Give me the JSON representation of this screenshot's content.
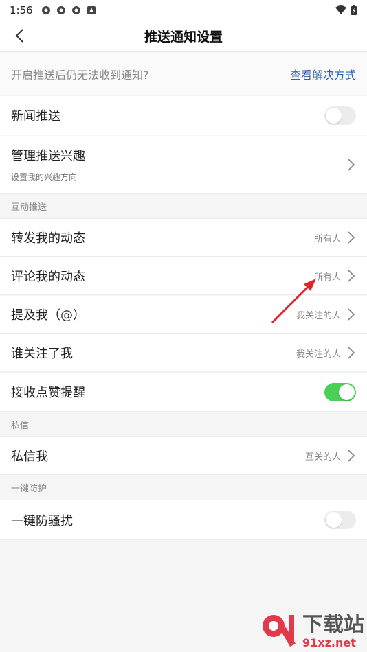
{
  "status": {
    "time": "1:56"
  },
  "header": {
    "title": "推送通知设置"
  },
  "hint": {
    "text": "开启推送后仍无法收到通知?",
    "link": "查看解决方式"
  },
  "news_push": {
    "label": "新闻推送",
    "on": false
  },
  "interests": {
    "label": "管理推送兴趣",
    "sub": "设置我的兴趣方向"
  },
  "section_interact": "互动推送",
  "interact": [
    {
      "label": "转发我的动态",
      "value": "所有人"
    },
    {
      "label": "评论我的动态",
      "value": "所有人"
    },
    {
      "label": "提及我（@）",
      "value": "我关注的人"
    },
    {
      "label": "谁关注了我",
      "value": "我关注的人"
    }
  ],
  "likes": {
    "label": "接收点赞提醒",
    "on": true
  },
  "section_dm": "私信",
  "dm": {
    "label": "私信我",
    "value": "互关的人"
  },
  "section_protect": "一键防护",
  "protect": {
    "label": "一键防骚扰",
    "on": false
  },
  "watermark": {
    "cn": "下载站",
    "en": "91xz.net"
  },
  "colors": {
    "toggle_on": "#4ccf56",
    "link": "#2f5fb0",
    "arrow": "#e0242e"
  }
}
